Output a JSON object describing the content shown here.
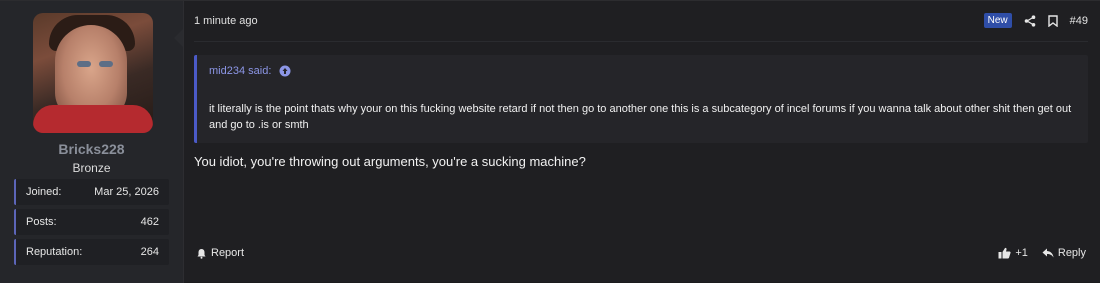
{
  "user": {
    "name": "Bricks228",
    "rank": "Bronze",
    "stats": [
      {
        "label": "Joined:",
        "value": "Mar 25, 2026"
      },
      {
        "label": "Posts:",
        "value": "462"
      },
      {
        "label": "Reputation:",
        "value": "264"
      }
    ]
  },
  "post": {
    "time": "1 minute ago",
    "badge_new": "New",
    "number": "#49",
    "quote_author": "mid234 said:",
    "quote_text": "it literally is the point thats why your on this fucking website retard if not then go to another one this is a subcategory of incel forums if you wanna talk about other shit then get out and go to .is or smth",
    "message": "You idiot, you're throwing out arguments, you're a sucking machine?"
  },
  "actions": {
    "report": "Report",
    "reactions": "+1",
    "reply": "Reply"
  },
  "icons": {
    "share": "share-icon",
    "bookmark": "bookmark-icon",
    "quote_up": "arrow-up-circle-icon",
    "report": "bell-icon",
    "like": "thumbs-up-icon",
    "reply": "reply-icon"
  },
  "colors": {
    "accent": "#4b5ac7",
    "badge": "#2f4ea8",
    "quote_author": "#8c96e6"
  }
}
